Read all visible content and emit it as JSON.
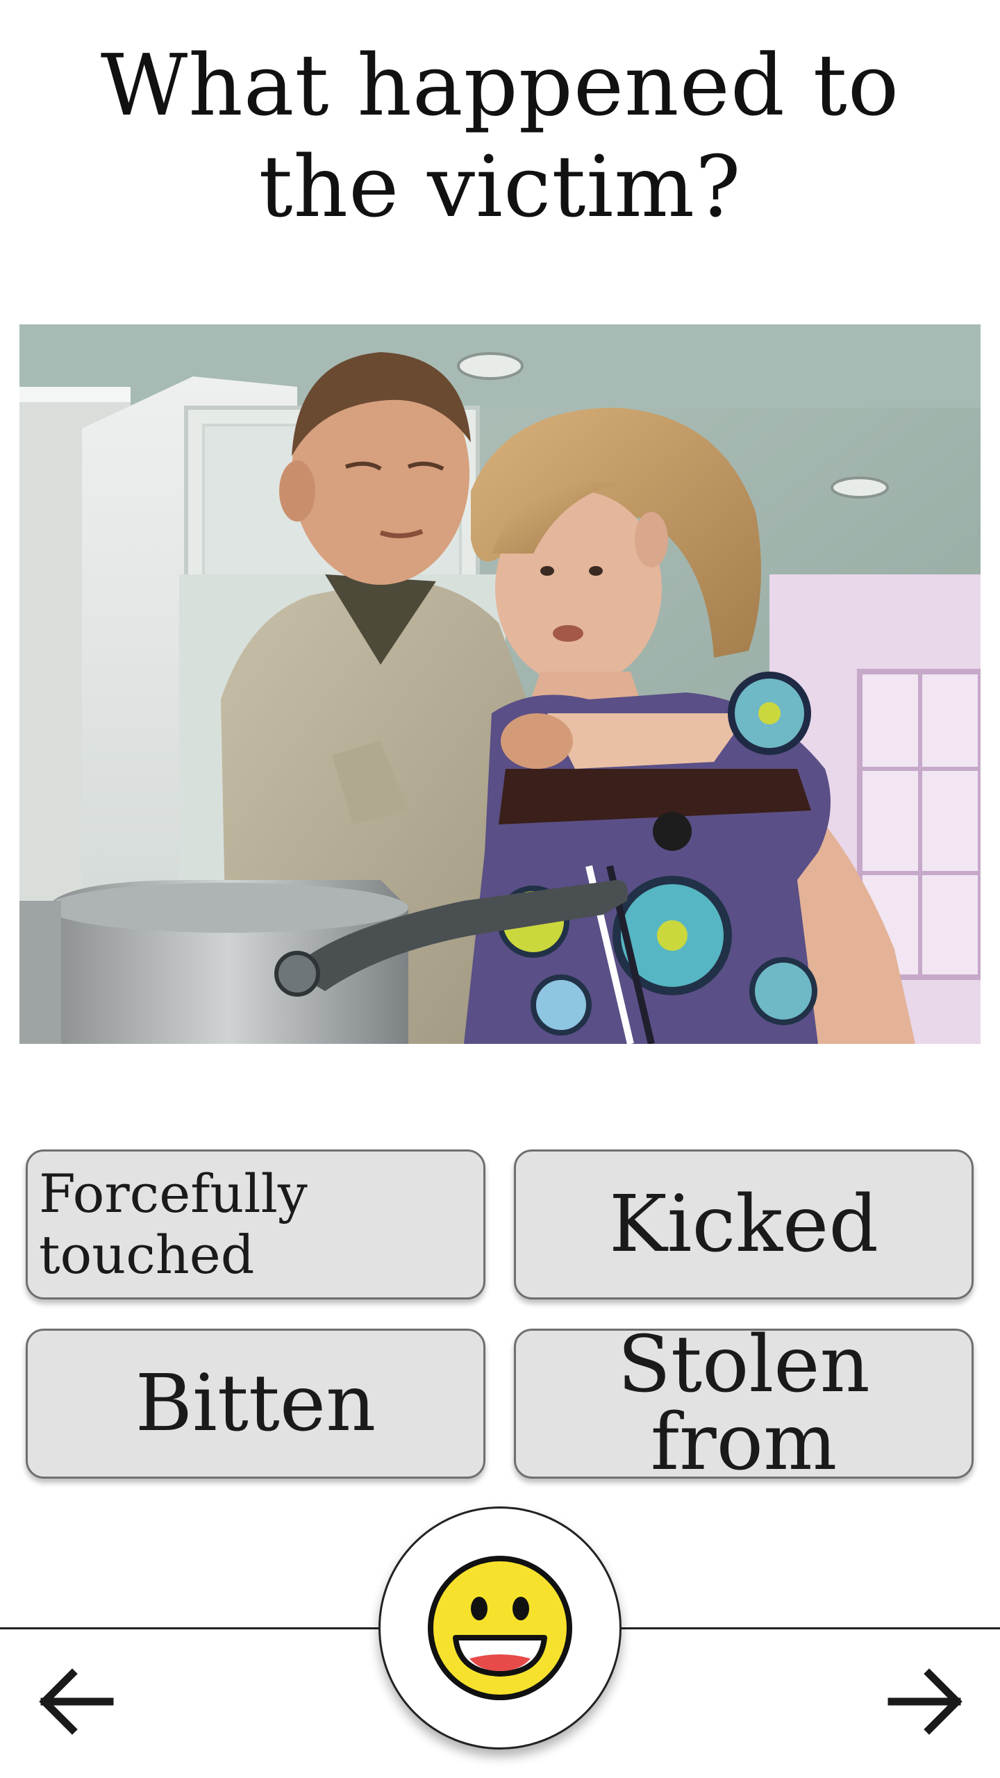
{
  "question": {
    "text": "What happened to the victim?"
  },
  "scene_image": {
    "icon": "kitchen-scene-photo"
  },
  "answers": [
    {
      "label": "Forcefully touched"
    },
    {
      "label": "Kicked"
    },
    {
      "label": "Bitten"
    },
    {
      "label": "Stolen from"
    }
  ],
  "feedback_button": {
    "icon": "smiling-face-icon"
  },
  "navigation": {
    "back_icon": "arrow-left-icon",
    "next_icon": "arrow-right-icon"
  },
  "colors": {
    "answer_background": "#e2e2e2",
    "answer_border": "#6f6f6f",
    "emoji_yellow": "#f6e22c"
  }
}
